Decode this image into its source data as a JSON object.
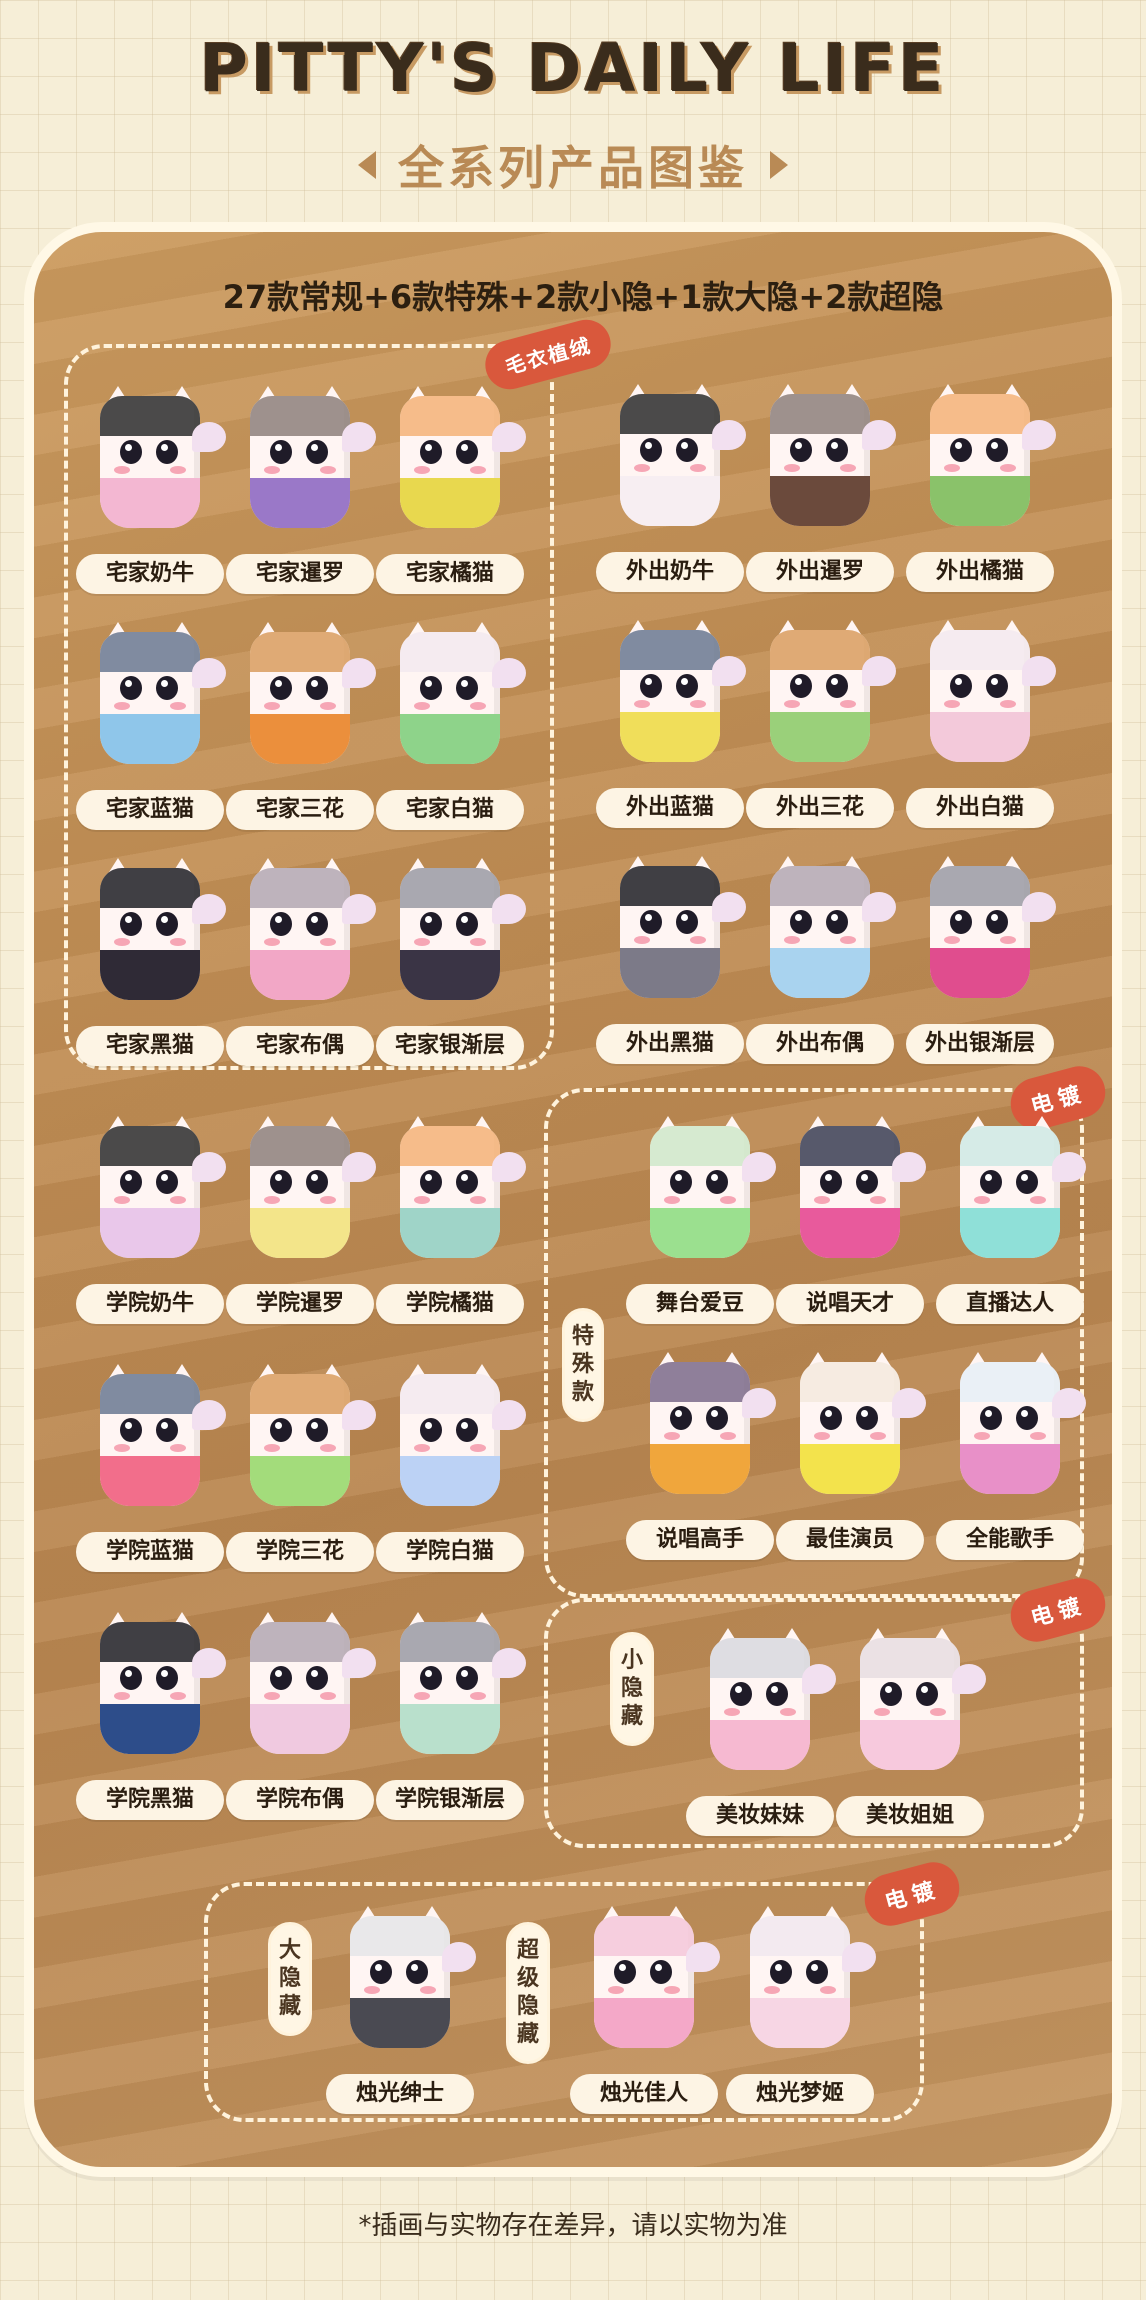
{
  "header": {
    "title": "PITTY'S DAILY LIFE",
    "subtitle": "全系列产品图鉴"
  },
  "board": {
    "series_summary": "27款常规+6款特殊+2款小隐+1款大隐+2款超隐",
    "tags": {
      "sweater_plush": "毛衣植绒",
      "plating_1": "电镀",
      "plating_2": "电镀",
      "plating_3": "电镀"
    },
    "side_labels": {
      "special": "特殊款",
      "small_hidden": "小隐藏",
      "big_hidden": "大隐藏",
      "super_hidden": "超级隐藏"
    }
  },
  "figures": {
    "home": [
      "宅家奶牛",
      "宅家暹罗",
      "宅家橘猫",
      "宅家蓝猫",
      "宅家三花",
      "宅家白猫",
      "宅家黑猫",
      "宅家布偶",
      "宅家银渐层"
    ],
    "out": [
      "外出奶牛",
      "外出暹罗",
      "外出橘猫",
      "外出蓝猫",
      "外出三花",
      "外出白猫",
      "外出黑猫",
      "外出布偶",
      "外出银渐层"
    ],
    "school": [
      "学院奶牛",
      "学院暹罗",
      "学院橘猫",
      "学院蓝猫",
      "学院三花",
      "学院白猫",
      "学院黑猫",
      "学院布偶",
      "学院银渐层"
    ],
    "special": [
      "舞台爱豆",
      "说唱天才",
      "直播达人",
      "说唱高手",
      "最佳演员",
      "全能歌手"
    ],
    "small_hidden": [
      "美妆妹妹",
      "美妆姐姐"
    ],
    "big_hidden": [
      "烛光绅士"
    ],
    "super_hidden": [
      "烛光佳人",
      "烛光梦姬"
    ]
  },
  "colors": {
    "background": "#f6eed7",
    "board": "#c28f55",
    "tag": "#d9583c",
    "label_bg": "#fdf4e4",
    "title": "#3a2c1c",
    "subtitle": "#b98a55"
  },
  "footer": {
    "note": "*插画与实物存在差异，请以实物为准"
  }
}
